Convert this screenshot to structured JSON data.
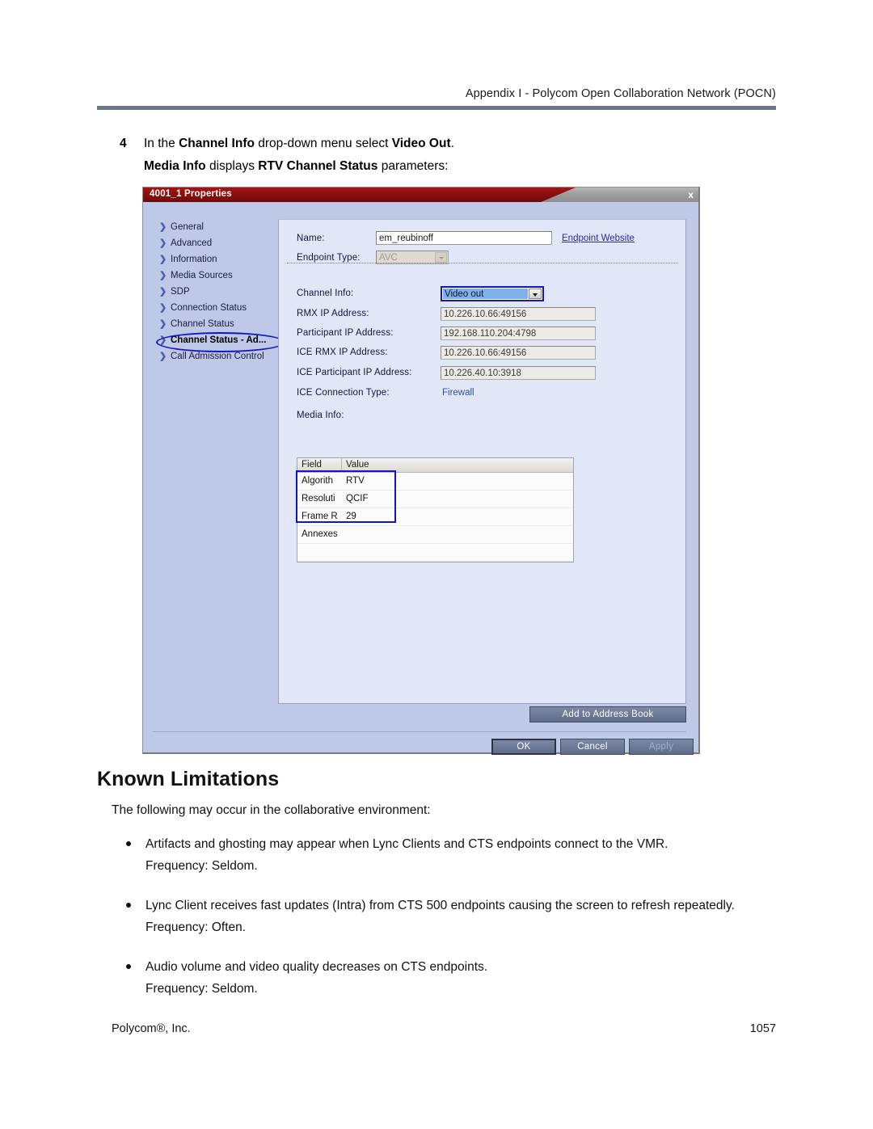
{
  "page": {
    "running_header": "Appendix I - Polycom Open Collaboration Network (POCN)",
    "footer_left": "Polycom®, Inc.",
    "footer_page_number": "1057"
  },
  "step": {
    "number": "4",
    "text_part1": "In the ",
    "bold1": "Channel Info",
    "text_part2": " drop-down menu select ",
    "bold2": "Video Out",
    "text_part3": ".",
    "sub_bold1": "Media Info",
    "sub_text1": " displays ",
    "sub_bold2": "RTV Channel Status",
    "sub_text2": " parameters:"
  },
  "dialog": {
    "title": "4001_1 Properties",
    "close_label": "x",
    "sidebar": [
      {
        "label": "General",
        "active": false
      },
      {
        "label": "Advanced",
        "active": false
      },
      {
        "label": "Information",
        "active": false
      },
      {
        "label": "Media Sources",
        "active": false
      },
      {
        "label": "SDP",
        "active": false
      },
      {
        "label": "Connection Status",
        "active": false
      },
      {
        "label": "Channel Status",
        "active": false
      },
      {
        "label": "Channel Status - Ad...",
        "active": true
      },
      {
        "label": "Call Admission Control",
        "active": false
      }
    ],
    "fields": {
      "name_label": "Name:",
      "name_value": "em_reubinoff",
      "endpoint_website_link": "Endpoint Website",
      "endpoint_type_label": "Endpoint Type:",
      "endpoint_type_value": "AVC",
      "channel_info_label": "Channel Info:",
      "channel_info_value": "Video out",
      "rmx_ip_label": "RMX IP Address:",
      "rmx_ip_value": "10.226.10.66:49156",
      "participant_ip_label": "Participant IP Address:",
      "participant_ip_value": "192.168.110.204:4798",
      "ice_rmx_ip_label": "ICE RMX IP Address:",
      "ice_rmx_ip_value": "10.226.10.66:49156",
      "ice_participant_ip_label": "ICE Participant IP Address:",
      "ice_participant_ip_value": "10.226.40.10:3918",
      "ice_connection_type_label": "ICE Connection Type:",
      "ice_connection_type_value": "Firewall",
      "media_info_label": "Media Info:"
    },
    "media_info_table": {
      "columns": [
        "Field",
        "Value"
      ],
      "rows": [
        {
          "field": "Algorith",
          "value": "RTV"
        },
        {
          "field": "Resoluti",
          "value": "QCIF"
        },
        {
          "field": "Frame R",
          "value": "29"
        },
        {
          "field": "Annexes",
          "value": ""
        },
        {
          "field": "",
          "value": ""
        }
      ]
    },
    "buttons": {
      "add_to_address_book": "Add to Address Book",
      "ok": "OK",
      "cancel": "Cancel",
      "apply": "Apply"
    },
    "colors": {
      "titlebar_red": "#8e0f0f",
      "dialog_face": "#bdc9e6",
      "panel_face": "#e2e7f7",
      "annotation_blue": "#1414c8",
      "button_face": "#5f6c8a"
    }
  },
  "article": {
    "heading": "Known Limitations",
    "intro": "The following may occur in the collaborative environment:",
    "items": [
      {
        "bullet": "Artifacts and ghosting may appear when Lync Clients and CTS endpoints connect to the VMR.",
        "frequency": "Frequency: Seldom."
      },
      {
        "bullet": "Lync Client receives fast updates (Intra) from CTS 500 endpoints causing the screen to refresh repeatedly.",
        "frequency": "Frequency: Often."
      },
      {
        "bullet": "Audio volume and video quality decreases on CTS endpoints.",
        "frequency": "Frequency: Seldom."
      }
    ]
  }
}
